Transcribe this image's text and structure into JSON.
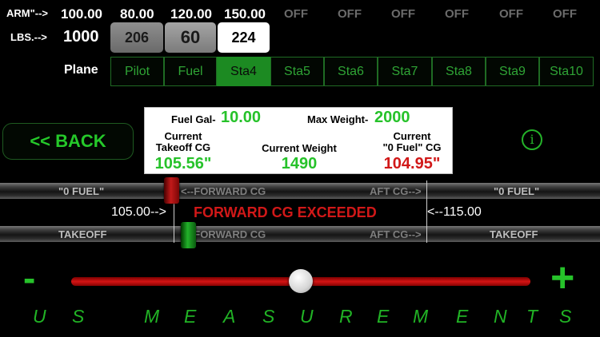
{
  "header": {
    "arm_label": "ARM\"-->",
    "lbs_label": "LBS.-->",
    "plane_label": "Plane",
    "arm_values": [
      "100.00",
      "80.00",
      "120.00",
      "150.00",
      "OFF",
      "OFF",
      "OFF",
      "OFF",
      "OFF",
      "OFF"
    ],
    "lbs_value": "1000",
    "weights": [
      "206",
      "60",
      "224"
    ]
  },
  "tabs": [
    "Pilot",
    "Fuel",
    "Sta4",
    "Sta5",
    "Sta6",
    "Sta7",
    "Sta8",
    "Sta9",
    "Sta10"
  ],
  "active_tab": "Sta4",
  "back_label": "<< BACK",
  "info_icon": "i",
  "info_box": {
    "fuel_label": "Fuel Gal-",
    "fuel_value": "10.00",
    "max_label": "Max Weight-",
    "max_value": "2000",
    "takeoff_cg_label_1": "Current",
    "takeoff_cg_label_2": "Takeoff CG",
    "takeoff_cg_value": "105.56\"",
    "current_weight_label": "Current Weight",
    "current_weight_value": "1490",
    "zero_fuel_label_1": "Current",
    "zero_fuel_label_2": "\"0 Fuel\" CG",
    "zero_fuel_value": "104.95\""
  },
  "rails": {
    "zero_fuel_left": "\"0 FUEL\"",
    "zero_fuel_right": "\"0 FUEL\"",
    "forward_cg": "<--FORWARD CG",
    "aft_cg": "AFT CG-->",
    "takeoff_left": "TAKEOFF",
    "takeoff_right": "TAKEOFF"
  },
  "limits": {
    "fwd_limit": "105.00-->",
    "aft_limit": "<--115.00",
    "warning": "FORWARD CG EXCEEDED"
  },
  "slider": {
    "minus": "-",
    "plus": "+",
    "level": 0.5
  },
  "footer": {
    "letters": [
      "U",
      "S",
      "M",
      "E",
      "A",
      "S",
      "U",
      "R",
      "E",
      "M",
      "E",
      "N",
      "T",
      "S"
    ]
  },
  "colors": {
    "accent_green": "#26c22a",
    "warning_red": "#d11818"
  }
}
